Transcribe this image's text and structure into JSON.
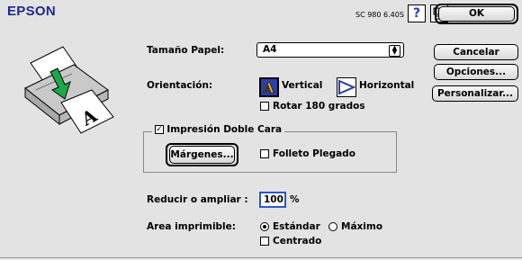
{
  "header": {
    "brand": "EPSON",
    "version": "SC 980 6.40S",
    "help_icon_glyph": "?"
  },
  "buttons": {
    "ok": "OK",
    "cancel": "Cancelar",
    "options": "Opciones...",
    "customize": "Personalizar..."
  },
  "paper_size": {
    "label": "Tamaño Papel:",
    "value": "A4"
  },
  "orientation": {
    "label": "Orientación:",
    "portrait_label": "Vertical",
    "landscape_label": "Horizontal",
    "selected": "Vertical",
    "portrait_icon_glyph": "A",
    "rotate_label": "Rotar 180 grados",
    "rotate_checked": false
  },
  "duplex": {
    "label": "Impresión Doble Cara",
    "checked": true,
    "margins_button": "Márgenes...",
    "folded_label": "Folleto Plegado",
    "folded_checked": false
  },
  "zoom": {
    "label": "Reducir o ampliar :",
    "value": "100",
    "unit": "%"
  },
  "printable_area": {
    "label": "Area imprimible:",
    "standard_label": "Estándar",
    "maximum_label": "Máximo",
    "selected": "Estándar",
    "centered_label": "Centrado",
    "centered_checked": false
  },
  "colors": {
    "brand": "#1e2a8f",
    "accent": "#2b57c9",
    "arrow": "#1fa84a",
    "background": "#e3e3e3"
  },
  "icons": {
    "help": "help-icon",
    "model": "printer-model-icon",
    "printer": "printer-illustration-icon",
    "portrait": "portrait-orientation-icon",
    "landscape": "landscape-orientation-icon"
  }
}
